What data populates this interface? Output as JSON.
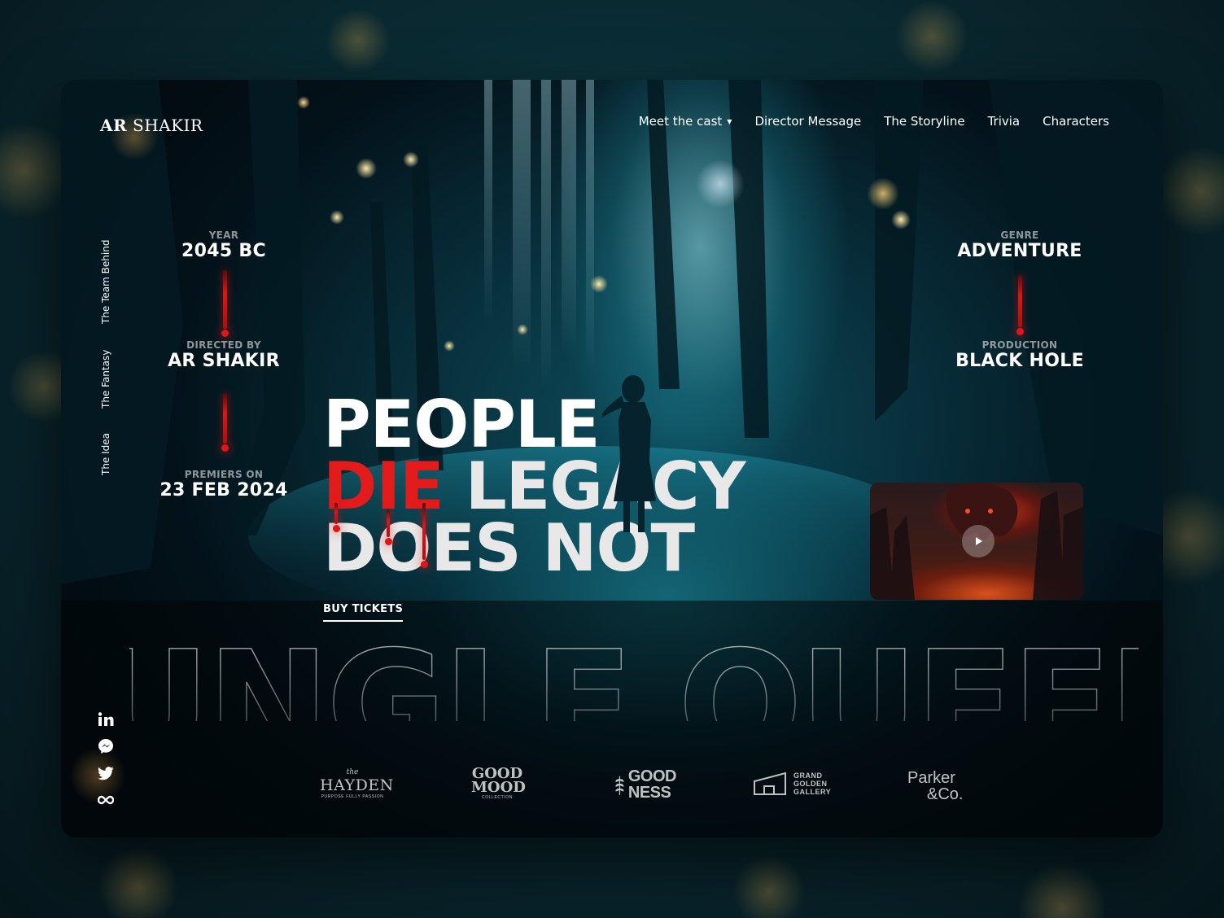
{
  "brand": {
    "bold": "AR",
    "light": "SHAKIR"
  },
  "nav": [
    {
      "label": "Meet the cast",
      "has_dropdown": true,
      "icon": "chevron-down-icon"
    },
    {
      "label": "Director Message"
    },
    {
      "label": "The Storyline"
    },
    {
      "label": "Trivia"
    },
    {
      "label": "Characters"
    }
  ],
  "side_nav": [
    "The Team Behind",
    "The Fantasy",
    "The Idea"
  ],
  "meta_left": [
    {
      "label": "YEAR",
      "value": "2045 BC"
    },
    {
      "label": "DIRECTED BY",
      "value": "AR SHAKIR"
    },
    {
      "label": "PREMIERS ON",
      "value": "23 FEB 2024"
    }
  ],
  "meta_right": [
    {
      "label": "GENRE",
      "value": "ADVENTURE"
    },
    {
      "label": "PRODUCTION",
      "value": "BLACK HOLE"
    }
  ],
  "headline": {
    "line1": "PEOPLE",
    "line2_red": "DIE",
    "line2_rest": "LEGACY",
    "line3": "DOES NOT"
  },
  "cta": {
    "buy_tickets": "BUY TICKETS"
  },
  "video": {
    "play_icon": "play-icon"
  },
  "big_title": "JUNGLE QUEEN",
  "social": [
    "linkedin-icon",
    "messenger-icon",
    "twitter-icon",
    "infinity-icon"
  ],
  "sponsors": {
    "hayden": {
      "top": "the",
      "name": "HAYDEN",
      "tagline": "PURPOSE FULLY PASSION"
    },
    "good_mood": {
      "line1": "GOOD",
      "line2": "MOOD",
      "tagline": "COLLECTION"
    },
    "goodness": {
      "line1": "GOOD",
      "line2": "NESS"
    },
    "grand": {
      "line1": "GRAND",
      "line2": "GOLDEN",
      "line3": "GALLERY"
    },
    "parker": {
      "line1": "Parker",
      "line2": "&Co."
    }
  },
  "colors": {
    "accent_red": "#e31b1b",
    "bg_teal": "#0a2b33",
    "text": "#ffffff"
  }
}
